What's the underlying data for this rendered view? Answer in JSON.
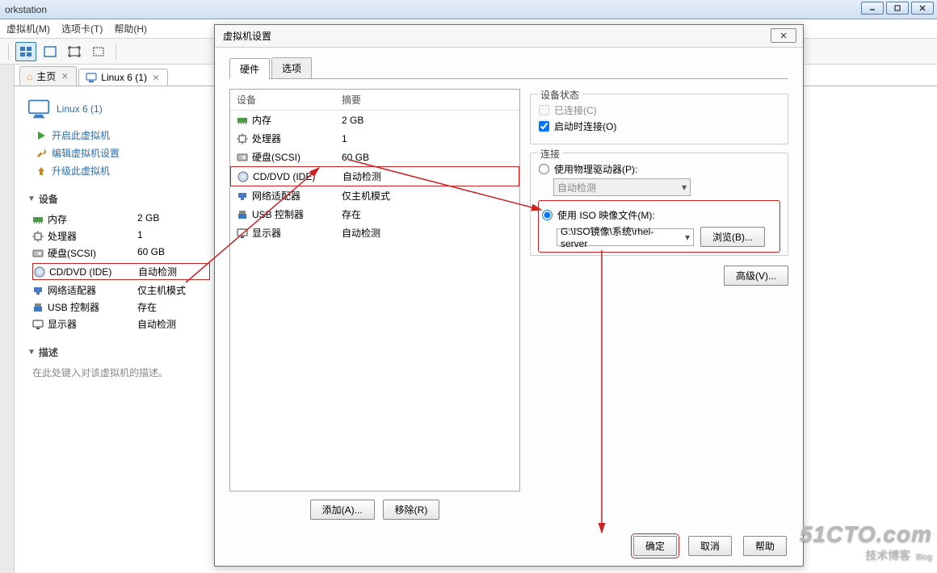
{
  "window": {
    "title_fragment": "orkstation"
  },
  "win_buttons": {
    "min": "min",
    "max": "max",
    "close": "close"
  },
  "menu": {
    "vm": "虚拟机(M)",
    "tabs": "选项卡(T)",
    "help": "帮助(H)"
  },
  "tabs": {
    "home": "主页",
    "vm": "Linux 6 (1)"
  },
  "vm": {
    "title": "Linux 6 (1)",
    "actions": {
      "power_on": "开启此虚拟机",
      "edit_settings": "编辑虚拟机设置",
      "upgrade": "升级此虚拟机"
    },
    "section_devices": "设备",
    "section_description": "描述",
    "description_placeholder": "在此处键入对该虚拟机的描述。"
  },
  "devices": [
    {
      "icon": "memory",
      "name": "内存",
      "summary": "2 GB"
    },
    {
      "icon": "cpu",
      "name": "处理器",
      "summary": "1"
    },
    {
      "icon": "disk",
      "name": "硬盘(SCSI)",
      "summary": "60 GB"
    },
    {
      "icon": "cd",
      "name": "CD/DVD (IDE)",
      "summary": "自动检测"
    },
    {
      "icon": "net",
      "name": "网络适配器",
      "summary": "仅主机模式"
    },
    {
      "icon": "usb",
      "name": "USB 控制器",
      "summary": "存在"
    },
    {
      "icon": "display",
      "name": "显示器",
      "summary": "自动检测"
    }
  ],
  "dialog": {
    "title": "虚拟机设置",
    "tab_hardware": "硬件",
    "tab_options": "选项",
    "col_device": "设备",
    "col_summary": "摘要",
    "btn_add": "添加(A)...",
    "btn_remove": "移除(R)",
    "group_status": "设备状态",
    "chk_connected": "已连接(C)",
    "chk_connect_poweron": "启动时连接(O)",
    "group_connection": "连接",
    "rdo_physical": "使用物理驱动器(P):",
    "combo_auto": "自动检测",
    "rdo_iso": "使用 ISO 映像文件(M):",
    "iso_path": "G:\\ISO镜像\\系统\\rhel-server",
    "btn_browse": "浏览(B)...",
    "btn_advanced": "高级(V)...",
    "btn_ok": "确定",
    "btn_cancel": "取消",
    "btn_help": "帮助"
  },
  "watermark": {
    "l1": "51CTO.com",
    "l2": "技术博客",
    "blog": "Blog"
  }
}
